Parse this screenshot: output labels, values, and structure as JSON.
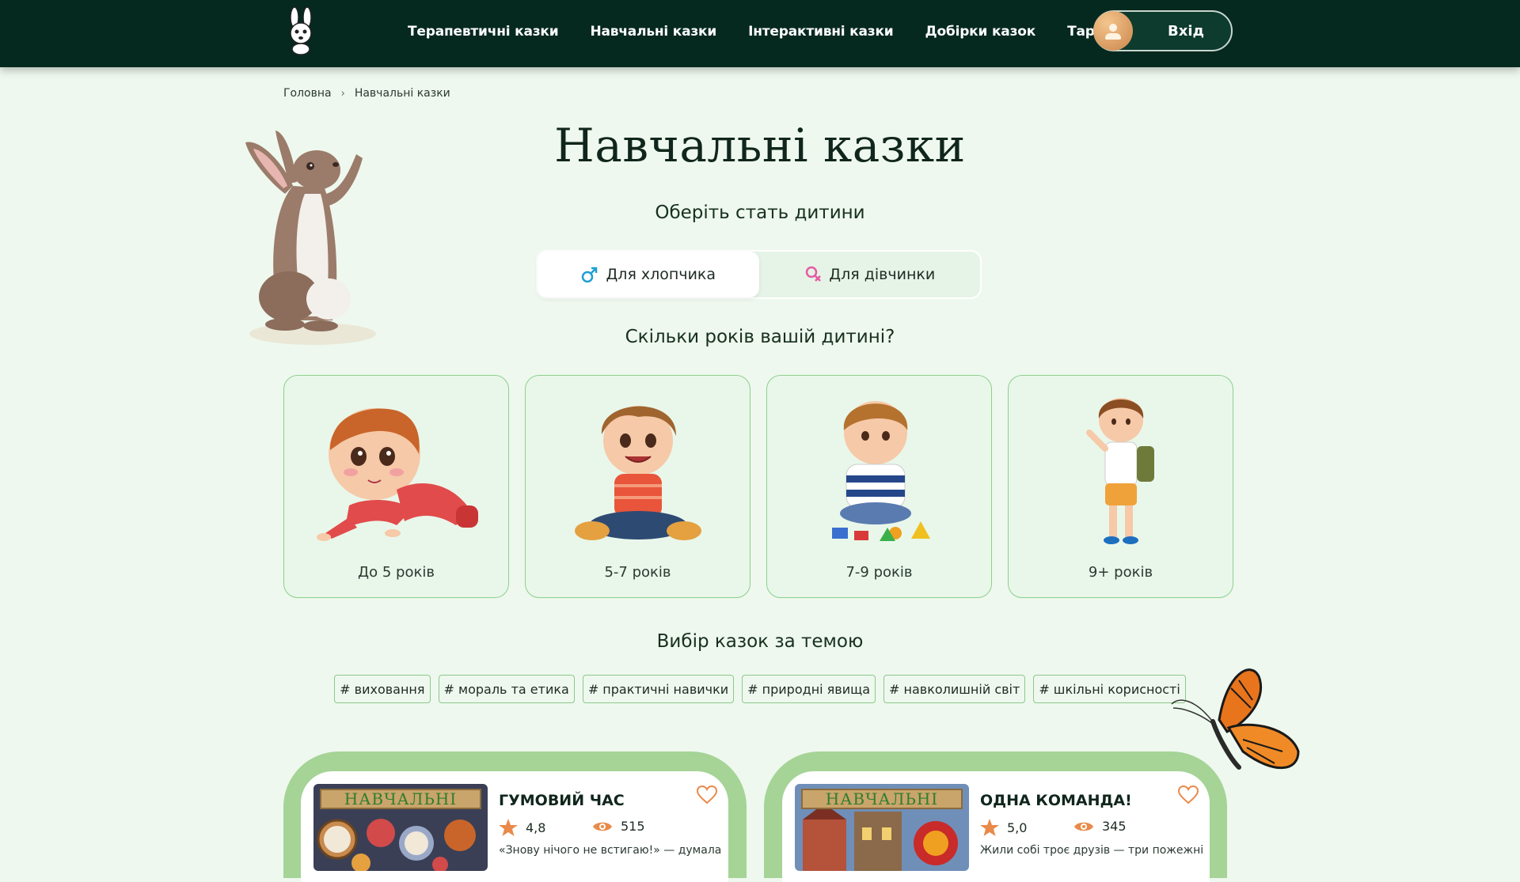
{
  "header": {
    "nav": [
      "Терапевтичні казки",
      "Навчальні казки",
      "Інтерактивні казки",
      "Добірки казок",
      "Тарифи"
    ],
    "login_label": "Вхід"
  },
  "breadcrumb": {
    "home": "Головна",
    "current": "Навчальні казки"
  },
  "page_title": "Навчальні казки",
  "gender": {
    "heading": "Оберіть стать дитини",
    "boy_label": "Для хлопчика",
    "girl_label": "Для дівчинки",
    "selected": "boy"
  },
  "age": {
    "heading": "Скільки років вашій дитині?",
    "options": [
      "До 5 років",
      "5-7 років",
      "7-9 років",
      "9+ років"
    ]
  },
  "topics": {
    "heading": "Вибір казок за темою",
    "tags": [
      "# виховання",
      "# мораль та етика",
      "# практичні навички",
      "# природні явища",
      "# навколишній світ",
      "# шкільні корисності"
    ]
  },
  "stories": [
    {
      "badge": "НАВЧАЛЬНІ",
      "title": "ГУМОВИЙ ЧАС",
      "rating": "4,8",
      "views": "515",
      "excerpt": "«Знову нічого не встигаю!» — думала"
    },
    {
      "badge": "НАВЧАЛЬНІ",
      "title": "ОДНА КОМАНДА!",
      "rating": "5,0",
      "views": "345",
      "excerpt": "Жили собі троє друзів — три пожежні"
    }
  ],
  "colors": {
    "header_bg": "#05291f",
    "page_bg": "#eef8ee",
    "card_border": "#8cd08c",
    "accent_orange": "#e98a4a"
  }
}
